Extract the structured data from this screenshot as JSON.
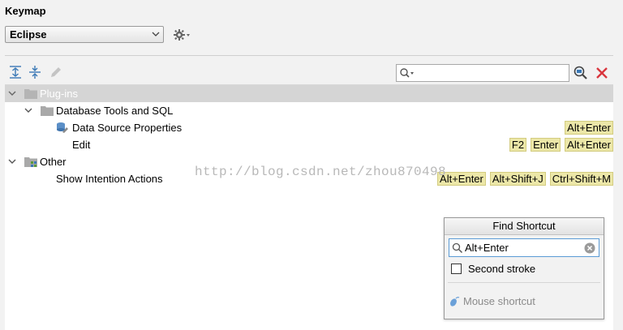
{
  "header": {
    "title": "Keymap",
    "scheme": "Eclipse"
  },
  "toolbar": {
    "expand_all": "expand-all-icon",
    "collapse_all": "collapse-all-icon",
    "edit": "pencil-icon",
    "search_value": "",
    "find_shortcut": "find-by-shortcut-icon",
    "clear": "close-icon"
  },
  "tree": {
    "rows": [
      {
        "label": "Plug-ins",
        "shortcuts": []
      },
      {
        "label": "Database Tools and SQL",
        "shortcuts": []
      },
      {
        "label": "Data Source Properties",
        "shortcuts": [
          "Alt+Enter"
        ]
      },
      {
        "label": "Edit",
        "shortcuts": [
          "F2",
          "Enter",
          "Alt+Enter"
        ]
      },
      {
        "label": "Other",
        "shortcuts": []
      },
      {
        "label": "Show Intention Actions",
        "shortcuts": [
          "Alt+Enter",
          "Alt+Shift+J",
          "Ctrl+Shift+M"
        ]
      }
    ]
  },
  "watermark": "http://blog.csdn.net/zhou870498",
  "find_shortcut": {
    "title": "Find Shortcut",
    "value": "Alt+Enter",
    "second_stroke": "Second stroke",
    "second_stroke_checked": false,
    "mouse_shortcut": "Mouse shortcut"
  },
  "colors": {
    "shortcut_bg": "#ece7a8",
    "selection": "#d5d5d5",
    "accent_border": "#5b9bd5",
    "clear_red": "#d9363e"
  }
}
